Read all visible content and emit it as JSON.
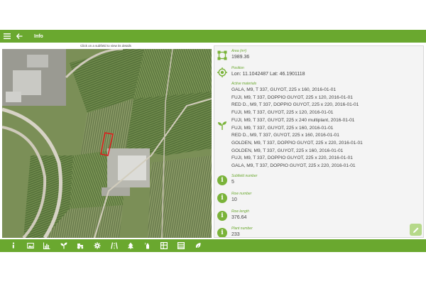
{
  "header": {
    "title": "Info",
    "menu_icon": "menu-icon",
    "back_icon": "back-arrow-icon"
  },
  "hint": "Click on a subfield to view its details",
  "colors": {
    "accent": "#6aa82f",
    "highlight": "#e01b1b"
  },
  "info": {
    "area": {
      "label": "Area (m²)",
      "value": "1989.36"
    },
    "position": {
      "label": "Position",
      "value": "Lon: 11.1042487  Lat: 46.1901118"
    },
    "materials": {
      "label": "Active materials",
      "items": [
        "GALA, M9, T 337, GUYOT, 225 x 160, 2016-01-01",
        "FUJI, M9, T 337, DOPPIO GUYOT, 225 x 120, 2016-01-01",
        "RED D., M9, T 337, DOPPIO GUYOT, 225 x 220, 2016-01-01",
        "FUJI, M9, T 337, GUYOT, 225 x 120, 2016-01-01",
        "FUJI, M9, T 337, GUYOT, 225 x 240 multiplant, 2016-01-01",
        "FUJI, M9, T 337, GUYOT, 225 x 160, 2016-01-01",
        "RED D., M9, T 337, GUYOT, 225 x 160, 2016-01-01",
        "GOLDEN, M9, T 337, DOPPIO GUYOT, 225 x 220, 2016-01-01",
        "GOLDEN, M9, T 337, GUYOT, 225 x 160, 2016-01-01",
        "FUJI, M9, T 337, DOPPIO GUYOT, 225 x 220, 2016-01-01",
        "GALA, M9, T 337, DOPPIO GUYOT, 225 x 220, 2016-01-01"
      ]
    },
    "subfield": {
      "label": "Subfield number",
      "value": "5"
    },
    "row_number": {
      "label": "Row number",
      "value": "10"
    },
    "row_length": {
      "label": "Row length",
      "value": "376.64"
    },
    "plant_number": {
      "label": "Plant number",
      "value": "233"
    }
  },
  "toolbar_icons": [
    "info-icon",
    "image-icon",
    "bar-chart-icon",
    "seedling-icon",
    "tractor-icon",
    "gear-icon",
    "road-icon",
    "tree-icon",
    "spray-icon",
    "grid-icon",
    "table-icon",
    "leaf-icon"
  ]
}
